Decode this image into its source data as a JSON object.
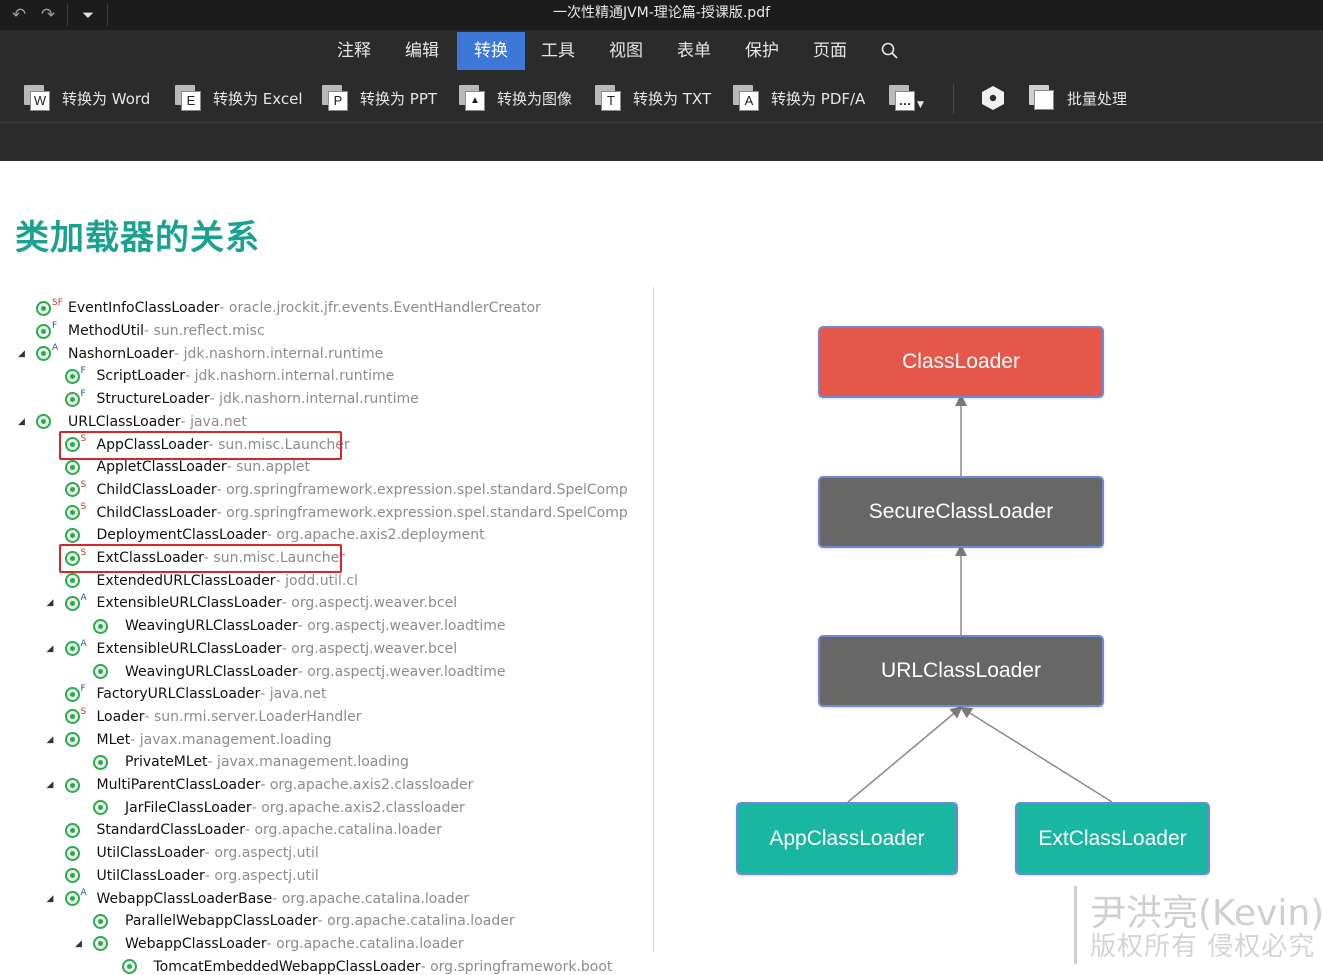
{
  "window": {
    "title": "一次性精通JVM-理论篇-授课版.pdf"
  },
  "quick_access": [
    {
      "icon": "undo-icon",
      "glyph": "↶"
    },
    {
      "icon": "redo-icon",
      "glyph": "↷"
    },
    {
      "icon": "quick-access-dropdown-icon",
      "glyph": "⏷"
    }
  ],
  "menu": {
    "tabs": [
      {
        "label": "注释",
        "active": false
      },
      {
        "label": "编辑",
        "active": false
      },
      {
        "label": "转换",
        "active": true
      },
      {
        "label": "工具",
        "active": false
      },
      {
        "label": "视图",
        "active": false
      },
      {
        "label": "表单",
        "active": false
      },
      {
        "label": "保护",
        "active": false
      },
      {
        "label": "页面",
        "active": false
      }
    ],
    "search_icon": "search-icon"
  },
  "toolbar": {
    "to_word": {
      "label": "转换为 Word",
      "letter": "W",
      "icon": "word-file-icon"
    },
    "to_excel": {
      "label": "转换为 Excel",
      "letter": "E",
      "icon": "excel-file-icon"
    },
    "to_ppt": {
      "label": "转换为 PPT",
      "letter": "P",
      "icon": "ppt-file-icon"
    },
    "to_image": {
      "label": "转换为图像",
      "letter": "▲",
      "icon": "image-file-icon"
    },
    "to_txt": {
      "label": "转换为 TXT",
      "letter": "T",
      "icon": "txt-file-icon"
    },
    "to_pdfa": {
      "label": "转换为 PDF/A",
      "letter": "A",
      "icon": "pdfa-file-icon"
    },
    "more": {
      "letter": "…",
      "icon": "more-formats-icon"
    },
    "ocr": {
      "icon": "ocr-hexagon-icon"
    },
    "batch": {
      "label": "批量处理",
      "icon": "batch-process-icon"
    }
  },
  "slide": {
    "title": "类加载器的关系",
    "tree": [
      {
        "name": "EventInfoClassLoader",
        "pkg": " - oracle.jrockit.jfr.events.EventHandlerCreator",
        "mod": "SF",
        "expander": ""
      },
      {
        "name": "MethodUtil",
        "pkg": " - sun.reflect.misc",
        "mod": "F",
        "expander": ""
      },
      {
        "name": "NashornLoader",
        "pkg": " - jdk.nashorn.internal.runtime",
        "mod": "A",
        "expander": "◢"
      },
      {
        "name": "ScriptLoader",
        "pkg": " - jdk.nashorn.internal.runtime",
        "mod": "F",
        "expander": ""
      },
      {
        "name": "StructureLoader",
        "pkg": " - jdk.nashorn.internal.runtime",
        "mod": "F",
        "expander": ""
      },
      {
        "name": "URLClassLoader",
        "pkg": " - java.net",
        "mod": "",
        "expander": "◢"
      },
      {
        "name": "AppClassLoader",
        "pkg": " - sun.misc.Launcher",
        "mod": "S",
        "expander": ""
      },
      {
        "name": "AppletClassLoader",
        "pkg": " - sun.applet",
        "mod": "",
        "expander": ""
      },
      {
        "name": "ChildClassLoader",
        "pkg": " - org.springframework.expression.spel.standard.SpelComp",
        "mod": "S",
        "expander": ""
      },
      {
        "name": "ChildClassLoader",
        "pkg": " - org.springframework.expression.spel.standard.SpelComp",
        "mod": "S",
        "expander": ""
      },
      {
        "name": "DeploymentClassLoader",
        "pkg": " - org.apache.axis2.deployment",
        "mod": "",
        "expander": ""
      },
      {
        "name": "ExtClassLoader",
        "pkg": " - sun.misc.Launcher",
        "mod": "S",
        "expander": ""
      },
      {
        "name": "ExtendedURLClassLoader",
        "pkg": " - jodd.util.cl",
        "mod": "",
        "expander": ""
      },
      {
        "name": "ExtensibleURLClassLoader",
        "pkg": " - org.aspectj.weaver.bcel",
        "mod": "A",
        "expander": "◢"
      },
      {
        "name": "WeavingURLClassLoader",
        "pkg": " - org.aspectj.weaver.loadtime",
        "mod": "",
        "expander": ""
      },
      {
        "name": "ExtensibleURLClassLoader",
        "pkg": " - org.aspectj.weaver.bcel",
        "mod": "A",
        "expander": "◢"
      },
      {
        "name": "WeavingURLClassLoader",
        "pkg": " - org.aspectj.weaver.loadtime",
        "mod": "",
        "expander": ""
      },
      {
        "name": "FactoryURLClassLoader",
        "pkg": " - java.net",
        "mod": "F",
        "expander": ""
      },
      {
        "name": "Loader",
        "pkg": " - sun.rmi.server.LoaderHandler",
        "mod": "S",
        "expander": ""
      },
      {
        "name": "MLet",
        "pkg": " - javax.management.loading",
        "mod": "",
        "expander": "◢"
      },
      {
        "name": "PrivateMLet",
        "pkg": " - javax.management.loading",
        "mod": "",
        "expander": ""
      },
      {
        "name": "MultiParentClassLoader",
        "pkg": " - org.apache.axis2.classloader",
        "mod": "",
        "expander": "◢"
      },
      {
        "name": "JarFileClassLoader",
        "pkg": " - org.apache.axis2.classloader",
        "mod": "",
        "expander": ""
      },
      {
        "name": "StandardClassLoader",
        "pkg": " - org.apache.catalina.loader",
        "mod": "",
        "expander": ""
      },
      {
        "name": "UtilClassLoader",
        "pkg": " - org.aspectj.util",
        "mod": "",
        "expander": ""
      },
      {
        "name": "UtilClassLoader",
        "pkg": " - org.aspectj.util",
        "mod": "",
        "expander": ""
      },
      {
        "name": "WebappClassLoaderBase",
        "pkg": " - org.apache.catalina.loader",
        "mod": "A",
        "expander": "◢"
      },
      {
        "name": "ParallelWebappClassLoader",
        "pkg": " - org.apache.catalina.loader",
        "mod": "",
        "expander": ""
      },
      {
        "name": "WebappClassLoader",
        "pkg": " - org.apache.catalina.loader",
        "mod": "",
        "expander": "◢"
      },
      {
        "name": "TomcatEmbeddedWebappClassLoader",
        "pkg": " - org.springframework.boot",
        "mod": "",
        "expander": ""
      }
    ],
    "diagram": {
      "nodes": {
        "classloader": "ClassLoader",
        "secure": "SecureClassLoader",
        "url": "URLClassLoader",
        "app": "AppClassLoader",
        "ext": "ExtClassLoader"
      },
      "colors": {
        "root": "#e5574a",
        "middle": "#676767",
        "leaf": "#19b6a2",
        "border": "#6e8ad6"
      }
    },
    "watermark": {
      "line1": "尹洪亮(Kevin)",
      "line2": "版权所有 侵权必究"
    }
  }
}
